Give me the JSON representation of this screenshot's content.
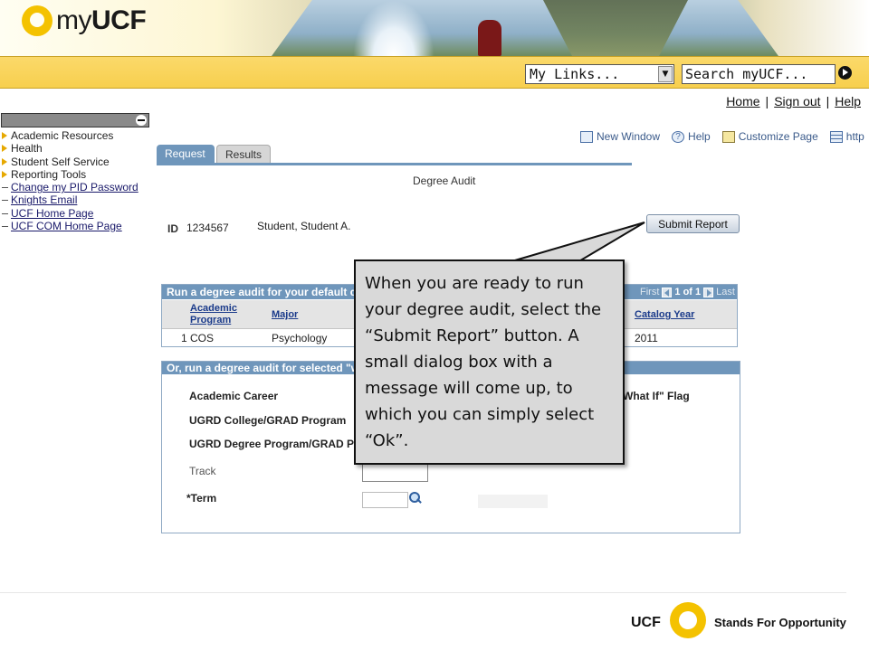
{
  "header": {
    "logo_prefix": "my",
    "logo_suffix": "UCF",
    "my_links_value": "My Links...",
    "search_value": "Search myUCF..."
  },
  "top_links": {
    "home": "Home",
    "sign_out": "Sign out",
    "help": "Help",
    "separator": "|"
  },
  "menu": {
    "items": [
      {
        "label": "Academic Resources",
        "type": "folder"
      },
      {
        "label": "Health",
        "type": "folder"
      },
      {
        "label": "Student Self Service",
        "type": "folder"
      },
      {
        "label": "Reporting Tools",
        "type": "folder"
      },
      {
        "label": "Change my PID Password",
        "type": "link"
      },
      {
        "label": "Knights Email",
        "type": "link"
      },
      {
        "label": "UCF Home Page",
        "type": "link"
      },
      {
        "label": "UCF COM Home Page",
        "type": "link"
      }
    ]
  },
  "page_tools": {
    "new_window": "New Window",
    "help": "Help",
    "customize": "Customize Page",
    "http": "http"
  },
  "tabs": [
    {
      "label": "Request"
    },
    {
      "label": "Results"
    }
  ],
  "page": {
    "title": "Degree Audit",
    "id_label": "ID",
    "id_value": "1234567",
    "student_name": "Student, Student A.",
    "submit_label": "Submit Report"
  },
  "grid1": {
    "header": "Run a degree audit for your default degre",
    "nav_first": "First",
    "nav_count": "1 of 1",
    "nav_last": "Last",
    "columns": {
      "program": "Academic Program",
      "major": "Major",
      "catalog": "Catalog Year"
    },
    "row": {
      "num": "1",
      "program": "COS",
      "major": "Psychology",
      "catalog": "2011"
    }
  },
  "group2": {
    "header": "Or, run a degree audit for selected \"what",
    "academic_career": "Academic Career",
    "college": "UGRD College/GRAD Program",
    "degree_program": "UGRD Degree Program/GRAD Plan",
    "track": "Track",
    "term": "*Term",
    "what_if_flag": "What If\" Flag"
  },
  "callout": {
    "text": "When you are ready to run your degree audit, select the “Submit Report” button. A small dialog box with a message will come up, to which you can simply select “Ok”."
  },
  "footer": {
    "ucf": "UCF",
    "tagline": "Stands For Opportunity"
  }
}
